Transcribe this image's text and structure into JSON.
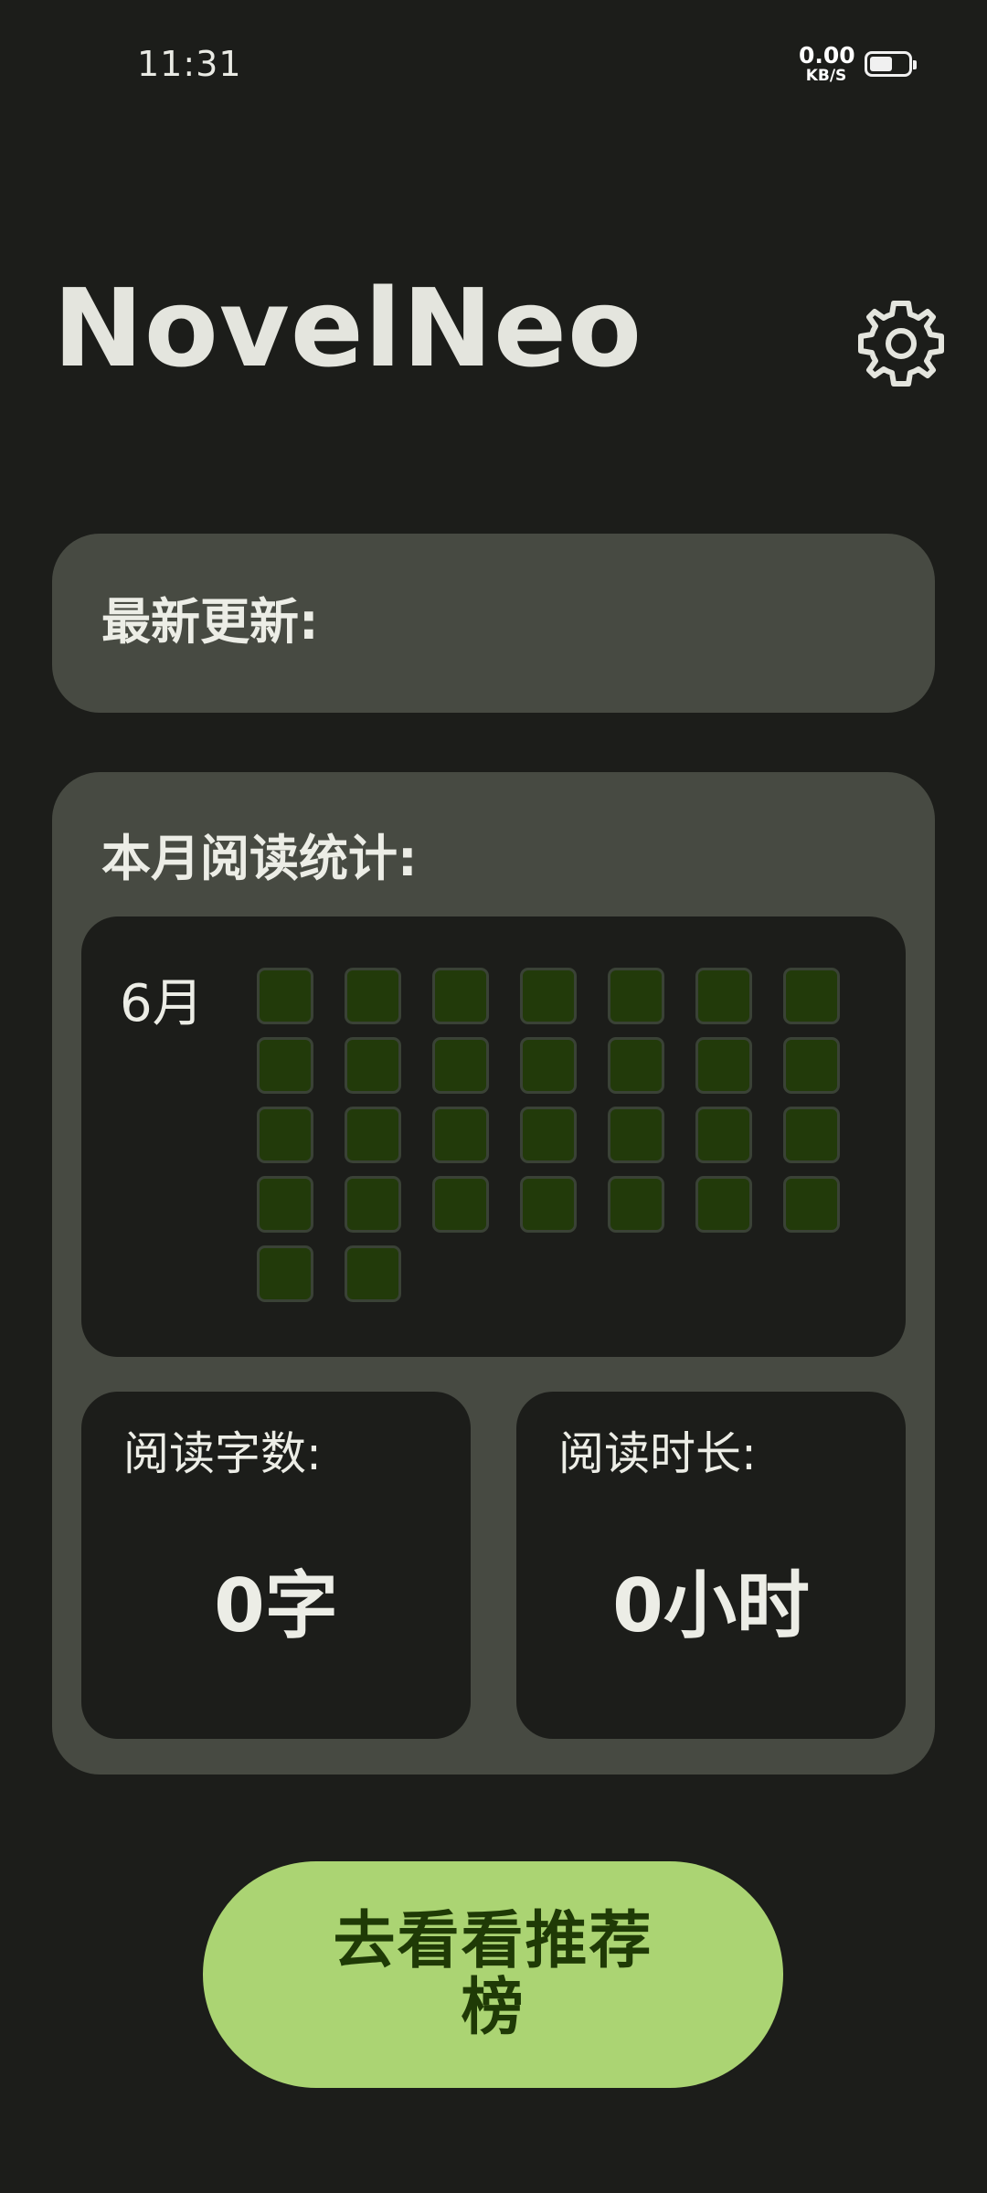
{
  "status_bar": {
    "time": "11:31",
    "net_speed_value": "0.00",
    "net_speed_unit": "KB/S",
    "battery_level": 0.6
  },
  "header": {
    "title": "NovelNeo",
    "settings_icon": "gear-icon"
  },
  "updates_card": {
    "label": "最新更新:"
  },
  "stats_card": {
    "label": "本月阅读统计:",
    "month_label": "6月",
    "days_in_month": 30,
    "day_cell_color": "#223a0a",
    "word_count": {
      "label": "阅读字数:",
      "value": "0字"
    },
    "reading_time": {
      "label": "阅读时长:",
      "value": "0小时"
    }
  },
  "cta": {
    "label": "去看看推荐榜",
    "color": "#abd473"
  }
}
